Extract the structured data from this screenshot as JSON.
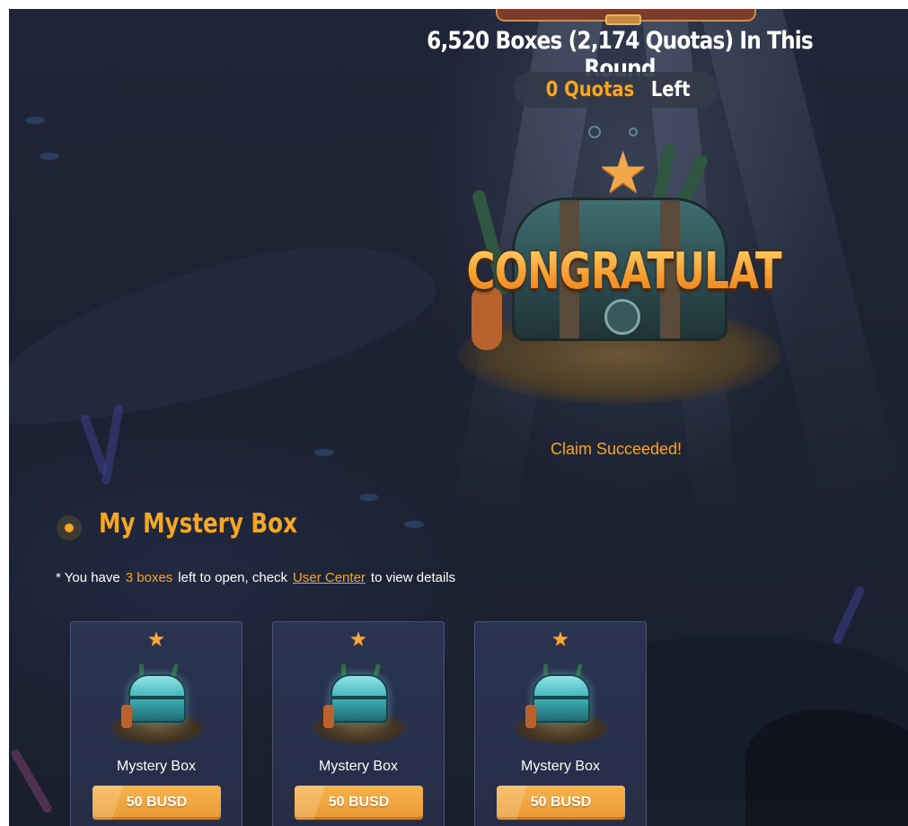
{
  "header": {
    "round_text": "6,520 Boxes (2,174 Quotas) In This Round",
    "quota_value": "0 Quotas",
    "quota_suffix": "Left"
  },
  "result": {
    "congrats_text": "CONGRATULATIONS",
    "claim_message": "Claim Succeeded!"
  },
  "my_box": {
    "title": "My Mystery Box",
    "info_prefix": "* You have",
    "box_count": "3 boxes",
    "info_middle": "left to open, check",
    "link_label": "User Center",
    "info_suffix": "to view details"
  },
  "cards": [
    {
      "name": "Mystery Box",
      "price": "50 BUSD"
    },
    {
      "name": "Mystery Box",
      "price": "50 BUSD"
    },
    {
      "name": "Mystery Box",
      "price": "50 BUSD"
    }
  ],
  "icons": {
    "star": "star-icon",
    "chest": "treasure-chest-icon"
  },
  "colors": {
    "accent": "#f5a623",
    "background": "#1e2333",
    "card": "#2a3350",
    "button": "#f0a63e"
  }
}
